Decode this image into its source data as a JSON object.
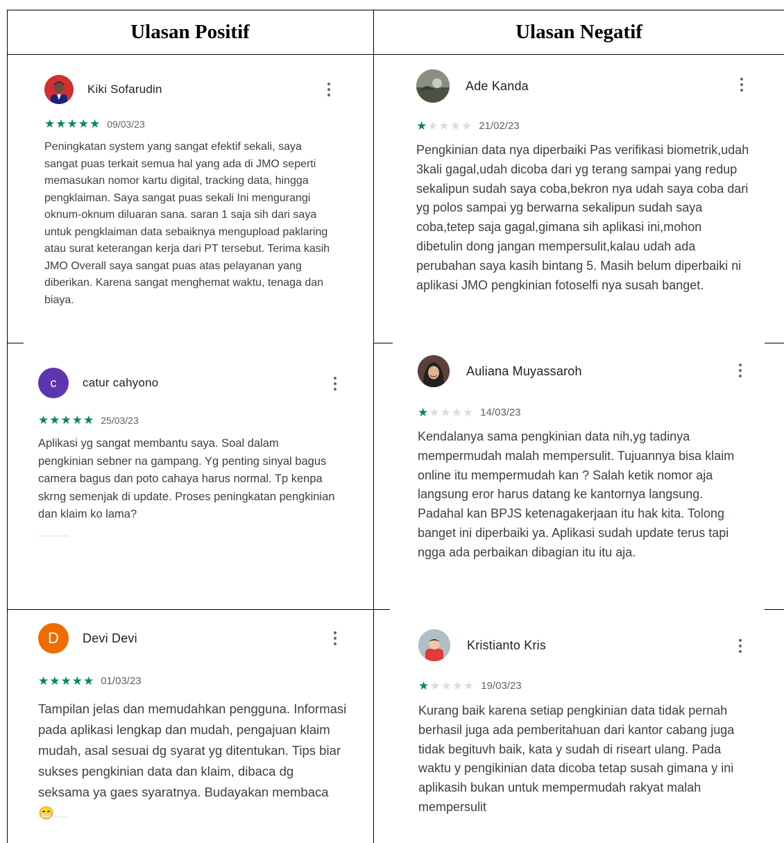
{
  "table": {
    "headers": {
      "positive": "Ulasan Positif",
      "negative": "Ulasan Negatif"
    }
  },
  "reviews": {
    "positive": [
      {
        "name": "Kiki Sofarudin",
        "date": "09/03/23",
        "rating": 5,
        "text": "Peningkatan system yang sangat efektif sekali, saya sangat puas terkait semua hal yang ada di JMO seperti memasukan nomor kartu digital, tracking data, hingga pengklaiman. Saya sangat puas sekali Ini mengurangi oknum-oknum diluaran sana. saran 1 saja sih dari saya untuk pengklaiman data sebaiknya mengupload paklaring atau surat keterangan kerja dari PT tersebut. Terima kasih JMO Overall saya sangat puas atas pelayanan yang diberikan. Karena sangat menghemat waktu, tenaga dan biaya."
      },
      {
        "name": "catur cahyono",
        "initial": "c",
        "date": "25/03/23",
        "rating": 5,
        "text": "Aplikasi yg sangat membantu saya. Soal dalam pengkinian sebner na gampang. Yg penting sinyal bagus camera bagus dan poto cahaya harus normal. Tp kenpa skrng semenjak di update. Proses peningkatan pengkinian dan klaim ko lama?"
      },
      {
        "name": "Devi Devi",
        "initial": "D",
        "date": "01/03/23",
        "rating": 5,
        "text": "Tampilan jelas dan memudahkan pengguna. Informasi pada aplikasi lengkap dan mudah, pengajuan klaim mudah, asal sesuai dg syarat yg ditentukan. Tips biar sukses pengkinian data dan klaim, dibaca dg seksama ya gaes syaratnya. Budayakan membaca 😁"
      }
    ],
    "negative": [
      {
        "name": "Ade Kanda",
        "date": "21/02/23",
        "rating": 1,
        "text": "Pengkinian data nya diperbaiki Pas verifikasi biometrik,udah 3kali gagal,udah dicoba dari yg terang sampai yang redup sekalipun sudah saya coba,bekron nya udah saya coba dari yg polos sampai yg berwarna sekalipun sudah saya coba,tetep saja gagal,gimana sih aplikasi ini,mohon dibetulin dong jangan mempersulit,kalau udah ada perubahan saya kasih bintang 5. Masih belum diperbaiki ni aplikasi JMO pengkinian fotoselfi nya susah banget."
      },
      {
        "name": "Auliana Muyassaroh",
        "date": "14/03/23",
        "rating": 1,
        "text": "Kendalanya sama pengkinian data nih,yg tadinya mempermudah malah mempersulit. Tujuannya bisa klaim online itu mempermudah kan ? Salah ketik nomor aja langsung eror harus datang ke kantornya langsung. Padahal kan BPJS ketenagakerjaan itu hak kita. Tolong banget ini diperbaiki ya. Aplikasi sudah update terus tapi ngga ada perbaikan dibagian itu itu aja."
      },
      {
        "name": "Kristianto Kris",
        "date": "19/03/23",
        "rating": 1,
        "text": "Kurang baik karena setiap pengkinian data tidak pernah berhasil juga ada pemberitahuan dari kantor cabang juga tidak begituvh baik, kata y sudah di riseart ulang. Pada waktu y pengikinian data dicoba tetap susah gimana y ini aplikasih bukan untuk mempermudah rakyat malah mempersulit"
      }
    ]
  },
  "colors": {
    "star_filled": "#01875f",
    "star_empty": "#dadce0",
    "avatar_purple": "#5e35b1",
    "avatar_orange": "#ef6c00"
  },
  "icons": {
    "more": "more-vert-icon",
    "star": "star-icon"
  }
}
